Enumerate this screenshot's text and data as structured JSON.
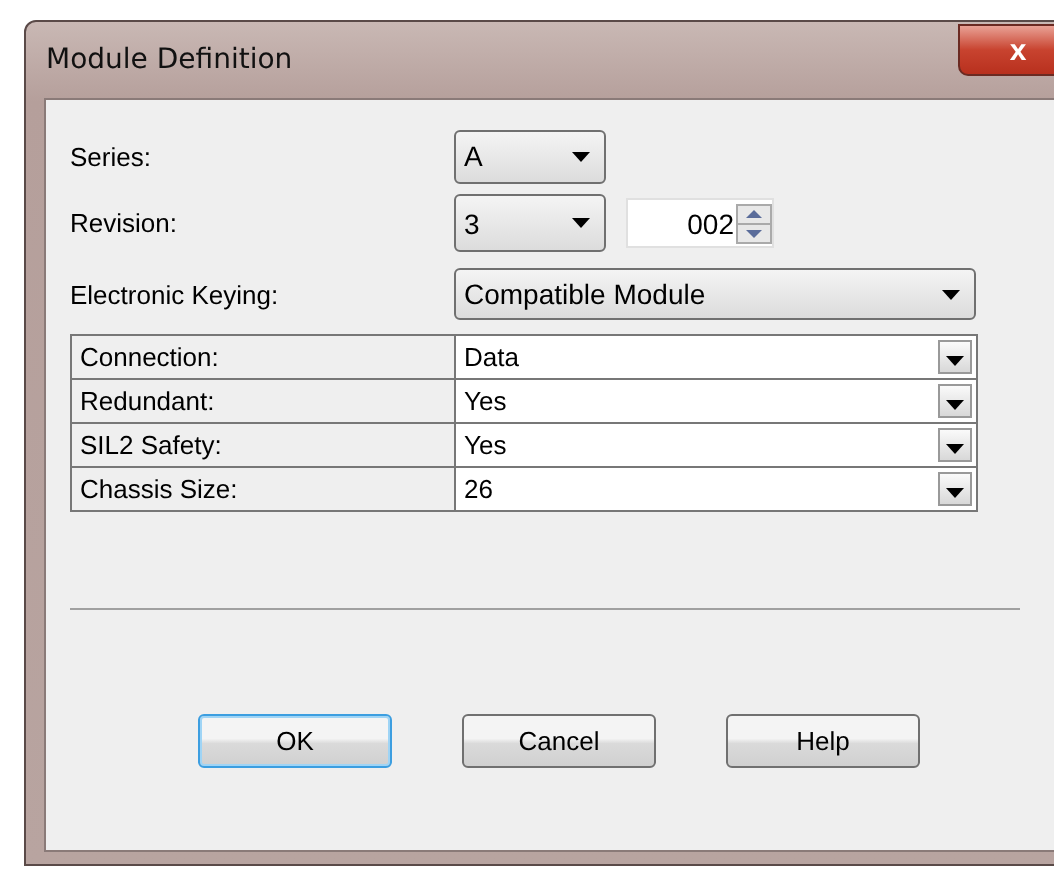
{
  "window": {
    "title": "Module Definition",
    "close": "x"
  },
  "series": {
    "label": "Series:",
    "value": "A"
  },
  "revision": {
    "label": "Revision:",
    "major": "3",
    "minor": "002"
  },
  "keying": {
    "label": "Electronic Keying:",
    "value": "Compatible Module"
  },
  "properties": [
    {
      "label": "Connection:",
      "value": "Data"
    },
    {
      "label": "Redundant:",
      "value": "Yes"
    },
    {
      "label": "SIL2 Safety:",
      "value": "Yes"
    },
    {
      "label": "Chassis Size:",
      "value": "26"
    }
  ],
  "buttons": [
    {
      "label": "OK",
      "default": true
    },
    {
      "label": "Cancel",
      "default": false
    },
    {
      "label": "Help",
      "default": false
    }
  ]
}
